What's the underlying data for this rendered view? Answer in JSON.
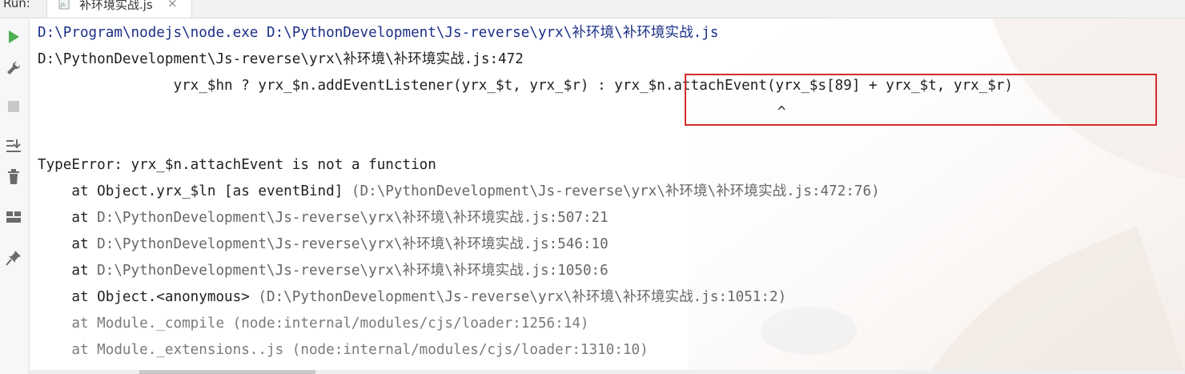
{
  "run_tab_bar": {
    "run_label": "Run:",
    "tab_title": "补环境实战.js",
    "tab_icon": "js-file-icon",
    "close_glyph": "×"
  },
  "toolbar": {
    "buttons": [
      {
        "name": "rerun-icon",
        "color": "#4caf50"
      },
      {
        "name": "wrench-icon"
      },
      {
        "name": "stop-icon"
      },
      {
        "name": "scroll-to-end-icon"
      },
      {
        "name": "trash-icon"
      },
      {
        "name": "layout-icon"
      },
      {
        "name": "pin-icon"
      }
    ]
  },
  "console": {
    "command_line": "D:\\Program\\nodejs\\node.exe D:\\PythonDevelopment\\Js-reverse\\yrx\\补环境\\补环境实战.js",
    "location_line": "D:\\PythonDevelopment\\Js-reverse\\yrx\\补环境\\补环境实战.js:472",
    "source_prefix": "                yrx_$hn ? yrx_$n.addEventListener(yrx_$t, yrx_$r) : ",
    "source_highlighted": "yrx_$n.attachEvent(yrx_$s[89] + yrx_$t, yrx_$r)",
    "caret_line": "          ^",
    "error_line": "TypeError: yrx_$n.attachEvent is not a function",
    "stack": [
      {
        "prefix": "    at Object.yrx_$ln [as eventBind] ",
        "location": "(D:\\PythonDevelopment\\Js-reverse\\yrx\\补环境\\补环境实战.js:472:76)"
      },
      {
        "prefix": "    at ",
        "location": "D:\\PythonDevelopment\\Js-reverse\\yrx\\补环境\\补环境实战.js:507:21"
      },
      {
        "prefix": "    at ",
        "location": "D:\\PythonDevelopment\\Js-reverse\\yrx\\补环境\\补环境实战.js:546:10"
      },
      {
        "prefix": "    at ",
        "location": "D:\\PythonDevelopment\\Js-reverse\\yrx\\补环境\\补环境实战.js:1050:6"
      },
      {
        "prefix": "    at Object.<anonymous> ",
        "location": "(D:\\PythonDevelopment\\Js-reverse\\yrx\\补环境\\补环境实战.js:1051:2)"
      },
      {
        "prefix": "    at Module._compile ",
        "location": "(node:internal/modules/cjs/loader:1256:14)"
      },
      {
        "prefix": "    at Module._extensions..js ",
        "location": "(node:internal/modules/cjs/loader:1310:10)"
      }
    ]
  },
  "colors": {
    "command": "#1b2f88",
    "highlight_border": "#d62b2b",
    "internal_frame": "#7a7a7a"
  }
}
